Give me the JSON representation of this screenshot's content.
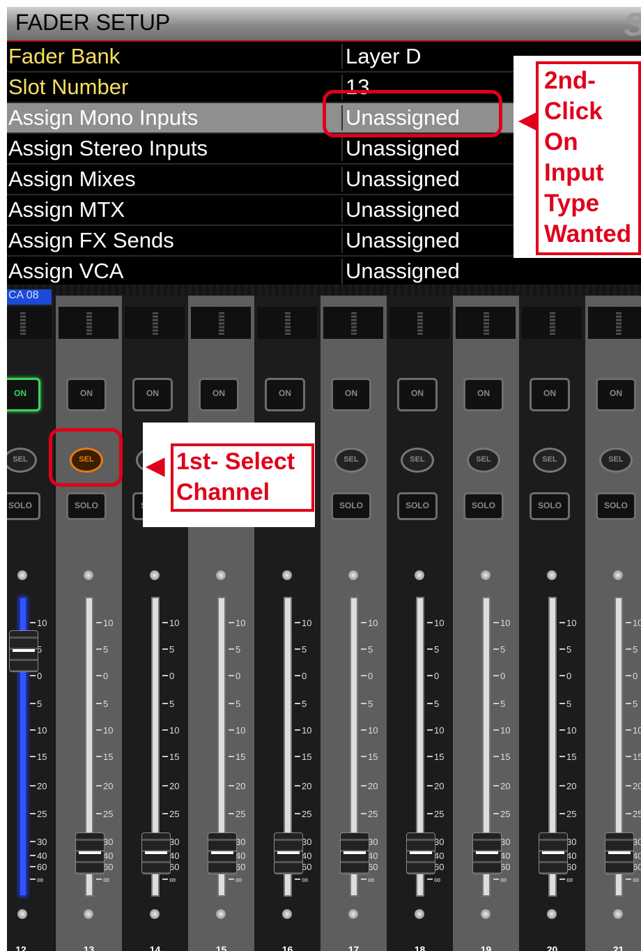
{
  "window": {
    "title": "FADER SETUP",
    "logo_text": "S"
  },
  "setup_rows": [
    {
      "label": "Fader Bank",
      "value": "Layer D"
    },
    {
      "label": "Slot Number",
      "value": "13"
    },
    {
      "label": "Assign Mono Inputs",
      "value": "Unassigned"
    },
    {
      "label": "Assign Stereo Inputs",
      "value": "Unassigned"
    },
    {
      "label": "Assign Mixes",
      "value": "Unassigned"
    },
    {
      "label": "Assign MTX",
      "value": "Unassigned"
    },
    {
      "label": "Assign FX Sends",
      "value": "Unassigned"
    },
    {
      "label": "Assign VCA",
      "value": "Unassigned"
    }
  ],
  "vca_tab": "CA 08",
  "buttons": {
    "on": "ON",
    "sel": "SEL",
    "solo": "SOLO"
  },
  "fader_scale": [
    "10",
    "5",
    "0",
    "5",
    "10",
    "15",
    "20",
    "25",
    "30",
    "40",
    "60",
    "∞"
  ],
  "channels": [
    {
      "number": "12",
      "on_active": true,
      "selected": false,
      "fader_level_db": "0"
    },
    {
      "number": "13",
      "on_active": false,
      "selected": true,
      "fader_level_db": "-∞"
    },
    {
      "number": "14",
      "on_active": false,
      "selected": false,
      "fader_level_db": "-∞"
    },
    {
      "number": "15",
      "on_active": false,
      "selected": false,
      "fader_level_db": "-∞"
    },
    {
      "number": "16",
      "on_active": false,
      "selected": false,
      "fader_level_db": "-∞"
    },
    {
      "number": "17",
      "on_active": false,
      "selected": false,
      "fader_level_db": "-∞"
    },
    {
      "number": "18",
      "on_active": false,
      "selected": false,
      "fader_level_db": "-∞"
    },
    {
      "number": "19",
      "on_active": false,
      "selected": false,
      "fader_level_db": "-∞"
    },
    {
      "number": "20",
      "on_active": false,
      "selected": false,
      "fader_level_db": "-∞"
    },
    {
      "number": "21",
      "on_active": false,
      "selected": false,
      "fader_level_db": "-∞"
    }
  ],
  "annotations": {
    "step1": "1st- Select Channel",
    "step1_lines": [
      "1st- Select",
      "Channel"
    ],
    "step2_lines": [
      "2nd-",
      "Click",
      "On",
      "Input",
      "Type",
      "Wanted"
    ]
  },
  "colors": {
    "annotation_red": "#e0001b",
    "on_green": "#36d85a",
    "sel_orange": "#e57a12",
    "vca_blue": "#3355ff"
  }
}
